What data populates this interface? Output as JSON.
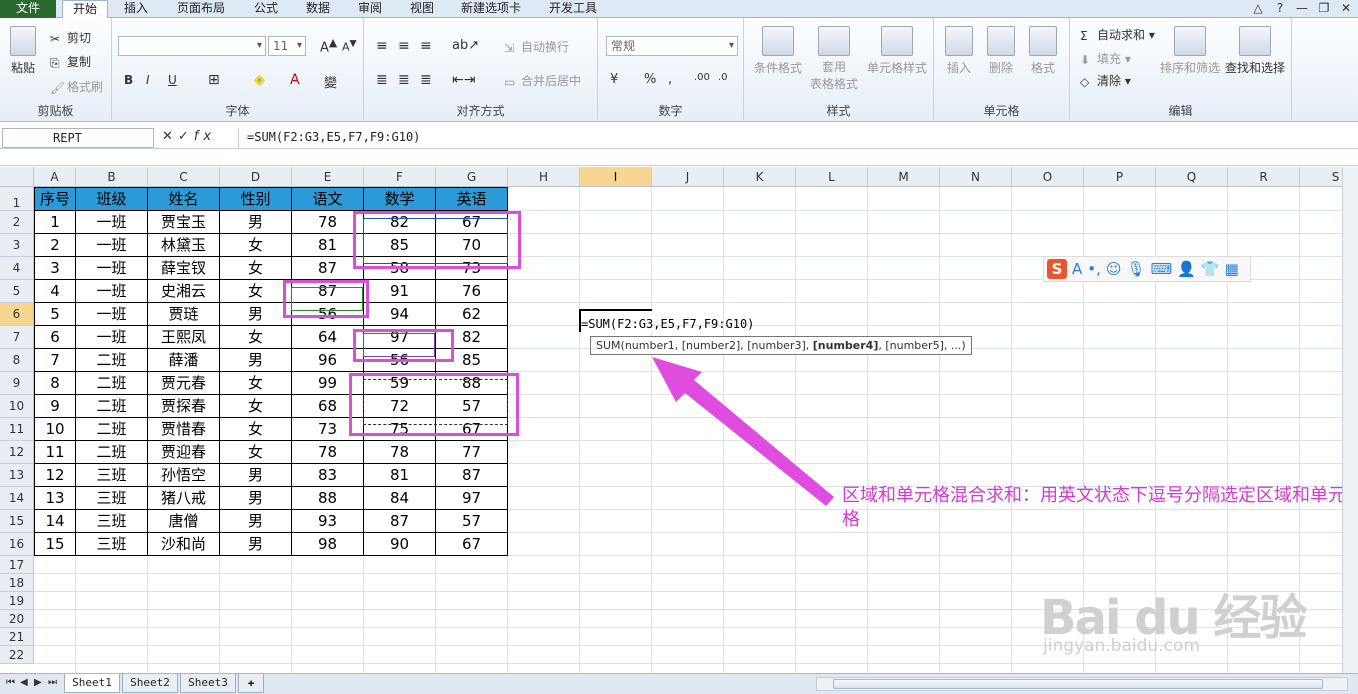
{
  "ribbon_tabs": [
    "文件",
    "开始",
    "插入",
    "页面布局",
    "公式",
    "数据",
    "审阅",
    "视图",
    "新建选项卡",
    "开发工具"
  ],
  "window_controls": [
    "△",
    "?",
    "—",
    "❐",
    "✕"
  ],
  "clipboard": {
    "paste": "粘贴",
    "cut": "剪切",
    "copy": "复制",
    "format_painter": "格式刷",
    "label": "剪贴板"
  },
  "font": {
    "size": "11",
    "label": "字体",
    "bold": "B",
    "italic": "I",
    "underline": "U"
  },
  "alignment": {
    "wrap": "自动换行",
    "merge": "合并后居中",
    "label": "对齐方式"
  },
  "number": {
    "format": "常规",
    "percent": "%",
    "label": "数字"
  },
  "styles": {
    "conditional": "条件格式",
    "table": "套用",
    "table2": "表格格式",
    "cell_styles": "单元格样式",
    "label": "样式"
  },
  "cells": {
    "insert": "插入",
    "delete": "删除",
    "format": "格式",
    "label": "单元格"
  },
  "editing": {
    "autosum": "自动求和",
    "fill": "填充",
    "clear": "清除",
    "sort": "排序和筛选",
    "find": "查找和选择",
    "label": "编辑"
  },
  "formula_bar": {
    "name_box": "REPT",
    "fx": "fx",
    "formula": "=SUM(F2:G3,E5,F7,F9:G10)"
  },
  "columns": [
    "A",
    "B",
    "C",
    "D",
    "E",
    "F",
    "G",
    "H",
    "I",
    "J",
    "K",
    "L",
    "M",
    "N",
    "O",
    "P",
    "Q",
    "R",
    "S"
  ],
  "rows": [
    "1",
    "2",
    "3",
    "4",
    "5",
    "6",
    "7",
    "8",
    "9",
    "10",
    "11",
    "12",
    "13",
    "14",
    "15",
    "16",
    "17",
    "18",
    "19",
    "20",
    "21",
    "22"
  ],
  "table": {
    "headers": [
      "序号",
      "班级",
      "姓名",
      "性别",
      "语文",
      "数学",
      "英语"
    ],
    "rows": [
      [
        "1",
        "一班",
        "贾宝玉",
        "男",
        "78",
        "82",
        "67"
      ],
      [
        "2",
        "一班",
        "林黛玉",
        "女",
        "81",
        "85",
        "70"
      ],
      [
        "3",
        "一班",
        "薛宝钗",
        "女",
        "87",
        "58",
        "73"
      ],
      [
        "4",
        "一班",
        "史湘云",
        "女",
        "87",
        "91",
        "76"
      ],
      [
        "5",
        "一班",
        "贾琏",
        "男",
        "56",
        "94",
        "62"
      ],
      [
        "6",
        "一班",
        "王熙凤",
        "女",
        "64",
        "97",
        "82"
      ],
      [
        "7",
        "二班",
        "薛潘",
        "男",
        "96",
        "56",
        "85"
      ],
      [
        "8",
        "二班",
        "贾元春",
        "女",
        "99",
        "59",
        "88"
      ],
      [
        "9",
        "二班",
        "贾探春",
        "女",
        "68",
        "72",
        "57"
      ],
      [
        "10",
        "二班",
        "贾惜春",
        "女",
        "73",
        "75",
        "67"
      ],
      [
        "11",
        "二班",
        "贾迎春",
        "女",
        "78",
        "78",
        "77"
      ],
      [
        "12",
        "三班",
        "孙悟空",
        "男",
        "83",
        "81",
        "87"
      ],
      [
        "13",
        "三班",
        "猪八戒",
        "男",
        "88",
        "84",
        "97"
      ],
      [
        "14",
        "三班",
        "唐僧",
        "男",
        "93",
        "87",
        "57"
      ],
      [
        "15",
        "三班",
        "沙和尚",
        "男",
        "98",
        "90",
        "67"
      ]
    ]
  },
  "edit_cell_text": "=SUM(F2:G3,E5,F7,F9:G10)",
  "tooltip": {
    "pre": "SUM(number1, [number2], [number3], ",
    "bold": "[number4]",
    "post": ", [number5], ...)"
  },
  "annotation": "区域和单元格混合求和：用英文状态下逗号分隔选定区域和单元格",
  "watermark": "Bai du 经验",
  "watermark_url": "jingyan.baidu.com",
  "sheets": [
    "Sheet1",
    "Sheet2",
    "Sheet3"
  ],
  "colors": {
    "accent": "#d94fd6",
    "header_fill": "#2c9ad6",
    "selection": "#f7d691"
  }
}
